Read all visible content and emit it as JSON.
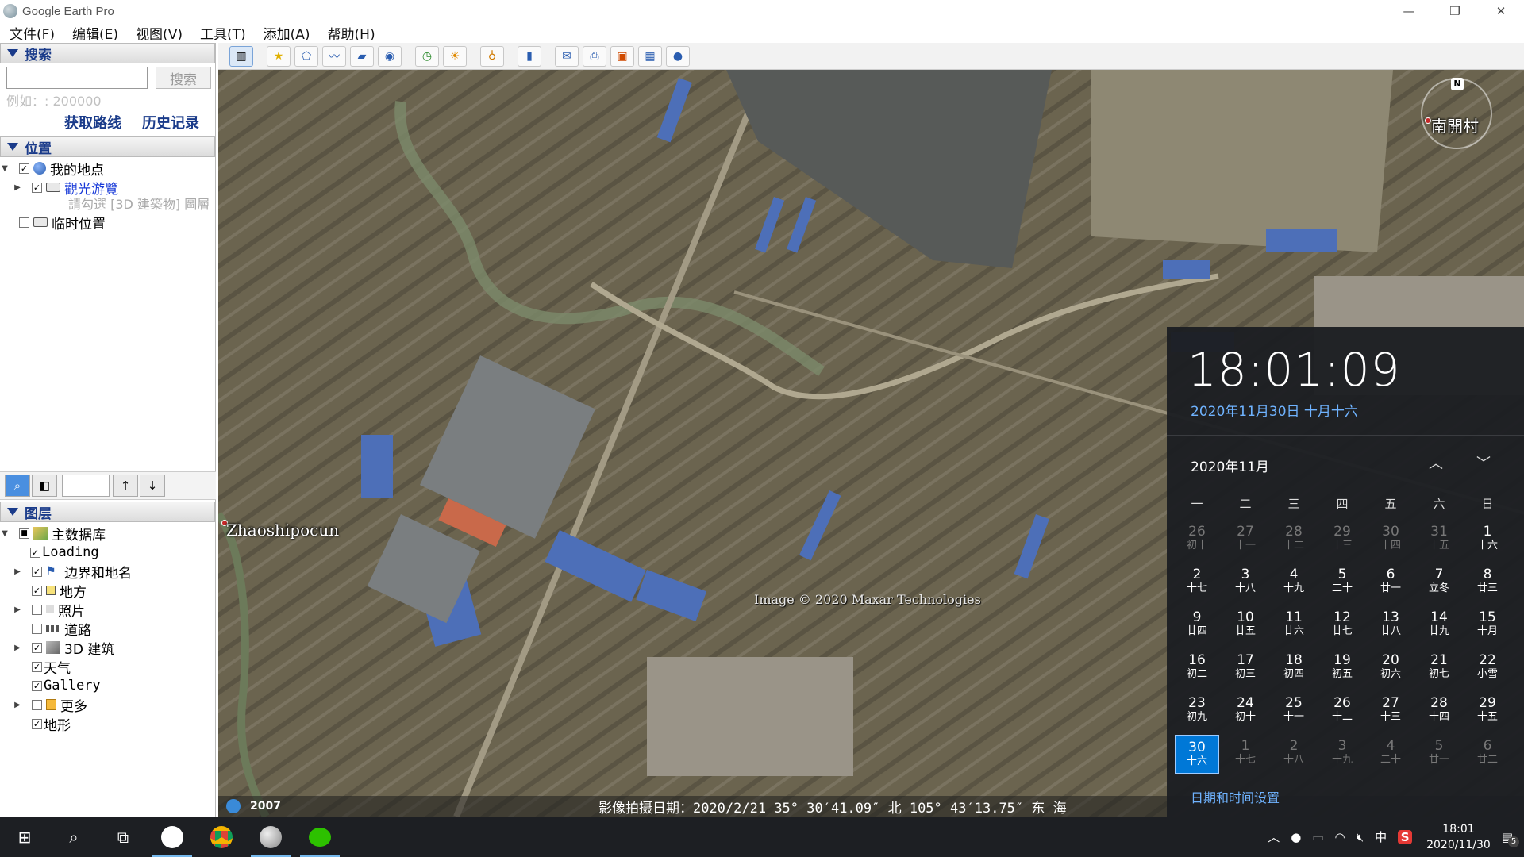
{
  "window": {
    "title": "Google Earth Pro",
    "controls": [
      "—",
      "❐",
      "✕"
    ]
  },
  "menu": [
    "文件(F)",
    "编辑(E)",
    "视图(V)",
    "工具(T)",
    "添加(A)",
    "帮助(H)"
  ],
  "search": {
    "header": "搜索",
    "button": "搜索",
    "input_value": "",
    "example": "例如：: 200000",
    "link_route": "获取路线",
    "link_history": "历史记录"
  },
  "places": {
    "header": "位置",
    "items": [
      {
        "label": "我的地点",
        "checked": true
      },
      {
        "label": "觀光游覽",
        "checked": true
      },
      {
        "label": "請勾選 [3D 建築物] 圖層",
        "note": true
      },
      {
        "label": "临时位置",
        "checked": false
      }
    ]
  },
  "layers": {
    "header": "图层",
    "items": [
      {
        "label": "主数据库"
      },
      {
        "label": "Loading"
      },
      {
        "label": "边界和地名"
      },
      {
        "label": "地方"
      },
      {
        "label": "照片"
      },
      {
        "label": "道路"
      },
      {
        "label": "3D 建筑"
      },
      {
        "label": "天气"
      },
      {
        "label": "Gallery"
      },
      {
        "label": "更多"
      },
      {
        "label": "地形"
      }
    ]
  },
  "map": {
    "label_village1": "南開村",
    "label_village2": "Zhaoshipocun",
    "copyright": "Image © 2020 Maxar Technologies",
    "compass_n": "N",
    "status_year": "2007",
    "status_text": "影像拍摄日期：2020/2/21   35° 30′41.09″ 北 105° 43′13.75″ 东  海"
  },
  "calendar": {
    "time": "18:01:09",
    "date_line": "2020年11月30日 十月十六",
    "month": "2020年11月",
    "weekdays": [
      "一",
      "二",
      "三",
      "四",
      "五",
      "六",
      "日"
    ],
    "settings": "日期和时间设置",
    "days": [
      {
        "n": "26",
        "l": "初十",
        "dim": true
      },
      {
        "n": "27",
        "l": "十一",
        "dim": true
      },
      {
        "n": "28",
        "l": "十二",
        "dim": true
      },
      {
        "n": "29",
        "l": "十三",
        "dim": true
      },
      {
        "n": "30",
        "l": "十四",
        "dim": true
      },
      {
        "n": "31",
        "l": "十五",
        "dim": true
      },
      {
        "n": "1",
        "l": "十六"
      },
      {
        "n": "2",
        "l": "十七"
      },
      {
        "n": "3",
        "l": "十八"
      },
      {
        "n": "4",
        "l": "十九"
      },
      {
        "n": "5",
        "l": "二十"
      },
      {
        "n": "6",
        "l": "廿一"
      },
      {
        "n": "7",
        "l": "立冬"
      },
      {
        "n": "8",
        "l": "廿三"
      },
      {
        "n": "9",
        "l": "廿四"
      },
      {
        "n": "10",
        "l": "廿五"
      },
      {
        "n": "11",
        "l": "廿六"
      },
      {
        "n": "12",
        "l": "廿七"
      },
      {
        "n": "13",
        "l": "廿八"
      },
      {
        "n": "14",
        "l": "廿九"
      },
      {
        "n": "15",
        "l": "十月"
      },
      {
        "n": "16",
        "l": "初二"
      },
      {
        "n": "17",
        "l": "初三"
      },
      {
        "n": "18",
        "l": "初四"
      },
      {
        "n": "19",
        "l": "初五"
      },
      {
        "n": "20",
        "l": "初六"
      },
      {
        "n": "21",
        "l": "初七"
      },
      {
        "n": "22",
        "l": "小雪"
      },
      {
        "n": "23",
        "l": "初九"
      },
      {
        "n": "24",
        "l": "初十"
      },
      {
        "n": "25",
        "l": "十一"
      },
      {
        "n": "26",
        "l": "十二"
      },
      {
        "n": "27",
        "l": "十三"
      },
      {
        "n": "28",
        "l": "十四"
      },
      {
        "n": "29",
        "l": "十五"
      },
      {
        "n": "30",
        "l": "十六",
        "today": true
      },
      {
        "n": "1",
        "l": "十七",
        "dim": true
      },
      {
        "n": "2",
        "l": "十八",
        "dim": true
      },
      {
        "n": "3",
        "l": "十九",
        "dim": true
      },
      {
        "n": "4",
        "l": "二十",
        "dim": true
      },
      {
        "n": "5",
        "l": "廿一",
        "dim": true
      },
      {
        "n": "6",
        "l": "廿二",
        "dim": true
      }
    ]
  },
  "taskbar": {
    "ime": "中",
    "time": "18:01",
    "date": "2020/11/30",
    "notif_count": "5"
  }
}
